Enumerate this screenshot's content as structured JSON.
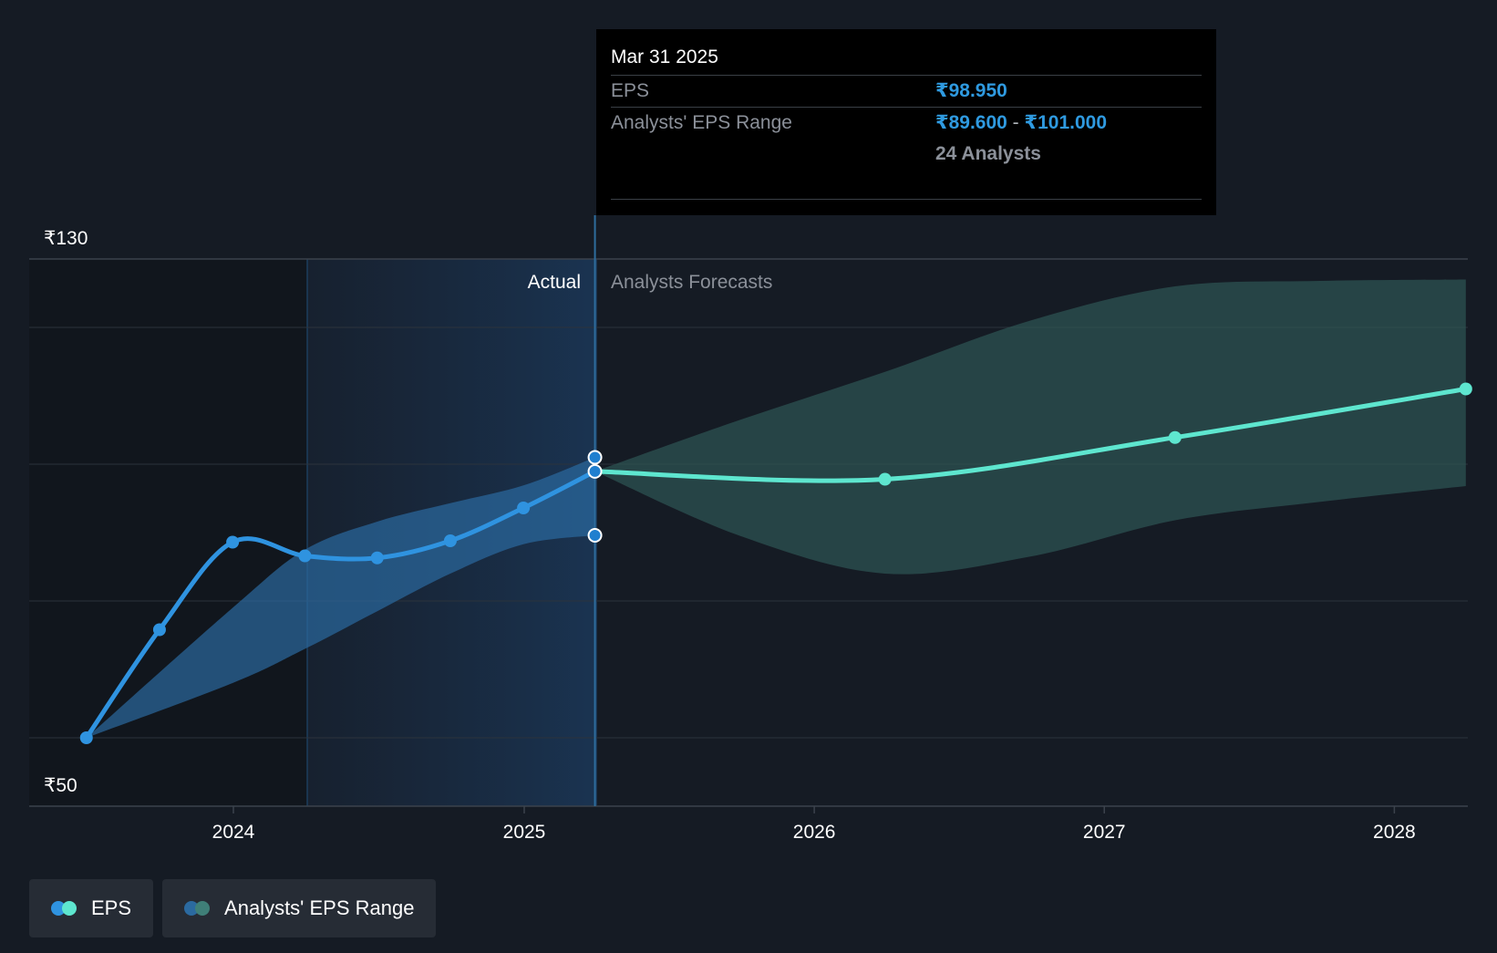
{
  "chart_data": {
    "type": "line",
    "y_axis": {
      "ylim": [
        50,
        130
      ],
      "tick_labels": [
        "₹130",
        "₹50"
      ],
      "gridlines": [
        60,
        80,
        100,
        120
      ]
    },
    "x_axis": {
      "tick_labels": [
        "2024",
        "2025",
        "2026",
        "2027",
        "2028"
      ]
    },
    "regions": {
      "actual_label": "Actual",
      "forecast_label": "Analysts Forecasts",
      "divider_date": "2025-03-31"
    },
    "series": [
      {
        "name": "EPS",
        "color": "#2f93e0",
        "points": [
          {
            "x": "2023-06-30",
            "y": 60.0
          },
          {
            "x": "2023-09-30",
            "y": 75.8
          },
          {
            "x": "2023-12-31",
            "y": 88.6
          },
          {
            "x": "2024-03-31",
            "y": 86.6
          },
          {
            "x": "2024-06-30",
            "y": 86.3
          },
          {
            "x": "2024-09-30",
            "y": 88.8
          },
          {
            "x": "2024-12-31",
            "y": 93.6
          },
          {
            "x": "2025-03-31",
            "y": 98.95
          }
        ]
      },
      {
        "name": "EPS forecast",
        "color": "#5ee6cf",
        "points": [
          {
            "x": "2025-03-31",
            "y": 98.95
          },
          {
            "x": "2026-03-31",
            "y": 97.8
          },
          {
            "x": "2027-03-31",
            "y": 103.9
          },
          {
            "x": "2028-03-31",
            "y": 111.0
          }
        ]
      }
    ],
    "range_series": [
      {
        "name": "Analysts' EPS Range (actual)",
        "color": "#2b6aa0",
        "points": [
          {
            "x": "2023-06-30",
            "low": 60.0,
            "high": 60.0
          },
          {
            "x": "2023-12-31",
            "low": 68.0,
            "high": 79.0
          },
          {
            "x": "2024-03-31",
            "low": 73.0,
            "high": 87.5
          },
          {
            "x": "2024-06-30",
            "low": 78.5,
            "high": 91.6
          },
          {
            "x": "2024-09-30",
            "low": 84.0,
            "high": 94.3
          },
          {
            "x": "2024-12-31",
            "low": 88.3,
            "high": 96.9
          },
          {
            "x": "2025-03-31",
            "low": 89.6,
            "high": 101.0
          }
        ]
      },
      {
        "name": "Analysts' EPS Range (forecast)",
        "color": "#2e5553",
        "points": [
          {
            "x": "2025-03-31",
            "low": 98.95,
            "high": 98.95
          },
          {
            "x": "2025-09-30",
            "low": 89.5,
            "high": 106.5
          },
          {
            "x": "2026-03-31",
            "low": 84.0,
            "high": 113.5
          },
          {
            "x": "2026-09-30",
            "low": 86.5,
            "high": 121.0
          },
          {
            "x": "2027-03-31",
            "low": 91.8,
            "high": 126.0
          },
          {
            "x": "2027-09-30",
            "low": 94.5,
            "high": 126.8
          },
          {
            "x": "2028-03-31",
            "low": 96.8,
            "high": 127.0
          }
        ]
      }
    ]
  },
  "tooltip": {
    "date": "Mar 31 2025",
    "eps_label": "EPS",
    "eps_value": "₹98.950",
    "range_label": "Analysts' EPS Range",
    "range_low": "₹89.600",
    "range_separator": " - ",
    "range_high": "₹101.000",
    "analysts": "24 Analysts"
  },
  "legend": {
    "eps": {
      "label": "EPS",
      "colors": [
        "#2f93e0",
        "#5ee6cf"
      ]
    },
    "range": {
      "label": "Analysts' EPS Range",
      "colors": [
        "#2b6aa0",
        "#3f7f78"
      ]
    }
  }
}
